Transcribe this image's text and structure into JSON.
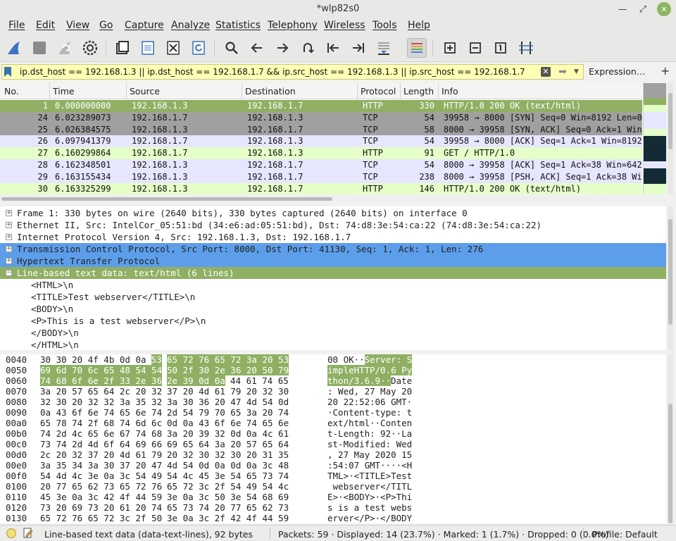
{
  "window": {
    "title": "*wlp82s0"
  },
  "menu": [
    "File",
    "Edit",
    "View",
    "Go",
    "Capture",
    "Analyze",
    "Statistics",
    "Telephony",
    "Wireless",
    "Tools",
    "Help"
  ],
  "toolbar_icons": [
    "shark-fin-start-icon",
    "stop-capture-icon",
    "restart-capture-icon",
    "capture-options-icon",
    "open-file-icon",
    "save-file-icon",
    "close-file-icon",
    "reload-file-icon",
    "find-packet-icon",
    "go-back-icon",
    "go-forward-icon",
    "go-to-packet-icon",
    "first-packet-icon",
    "last-packet-icon",
    "autoscroll-icon",
    "colorize-icon",
    "zoom-in-icon",
    "zoom-out-icon",
    "normal-size-icon",
    "resize-columns-icon"
  ],
  "filter": {
    "value": "ip.dst_host == 192.168.1.3 || ip.dst_host == 192.168.1.7 && ip.src_host == 192.168.1.3 || ip.src_host == 192.168.1.7",
    "expression_label": "Expression…",
    "add_label": "+"
  },
  "packet_columns": [
    "No.",
    "Time",
    "Source",
    "Destination",
    "Protocol",
    "Length",
    "Info"
  ],
  "packets": [
    {
      "no": "1",
      "time": "0.000000000",
      "src": "192.168.1.3",
      "dst": "192.168.1.7",
      "proto": "HTTP",
      "len": "330",
      "info": "HTTP/1.0 200 OK  (text/html)",
      "kind": "selected"
    },
    {
      "no": "24",
      "time": "6.023289073",
      "src": "192.168.1.7",
      "dst": "192.168.1.3",
      "proto": "TCP",
      "len": "54",
      "info": "39958 → 8000 [SYN] Seq=0 Win=8192 Len=0",
      "kind": "syn"
    },
    {
      "no": "25",
      "time": "6.026384575",
      "src": "192.168.1.3",
      "dst": "192.168.1.7",
      "proto": "TCP",
      "len": "58",
      "info": "8000 → 39958 [SYN, ACK] Seq=0 Ack=1 Win=64240",
      "kind": "syn"
    },
    {
      "no": "26",
      "time": "6.097941379",
      "src": "192.168.1.7",
      "dst": "192.168.1.3",
      "proto": "TCP",
      "len": "54",
      "info": "39958 → 8000 [ACK] Seq=1 Ack=1 Win=8192",
      "kind": "tcp"
    },
    {
      "no": "27",
      "time": "6.160299864",
      "src": "192.168.1.7",
      "dst": "192.168.1.3",
      "proto": "HTTP",
      "len": "91",
      "info": "GET / HTTP/1.0",
      "kind": "http"
    },
    {
      "no": "28",
      "time": "6.162348501",
      "src": "192.168.1.3",
      "dst": "192.168.1.7",
      "proto": "TCP",
      "len": "54",
      "info": "8000 → 39958 [ACK] Seq=1 Ack=38 Win=64203",
      "kind": "tcp"
    },
    {
      "no": "29",
      "time": "6.163155434",
      "src": "192.168.1.3",
      "dst": "192.168.1.7",
      "proto": "TCP",
      "len": "238",
      "info": "8000 → 39958 [PSH, ACK] Seq=1 Ack=38 Win=64203",
      "kind": "tcp"
    },
    {
      "no": "30",
      "time": "6.163325299",
      "src": "192.168.1.3",
      "dst": "192.168.1.7",
      "proto": "HTTP",
      "len": "146",
      "info": "HTTP/1.0 200 OK  (text/html)",
      "kind": "http"
    }
  ],
  "details": [
    {
      "text": "Frame 1: 330 bytes on wire (2640 bits), 330 bytes captured (2640 bits) on interface 0",
      "expander": "+",
      "style": "plain"
    },
    {
      "text": "Ethernet II, Src: IntelCor_05:51:bd (34:e6:ad:05:51:bd), Dst: 74:d8:3e:54:ca:22 (74:d8:3e:54:ca:22)",
      "expander": "+",
      "style": "plain"
    },
    {
      "text": "Internet Protocol Version 4, Src: 192.168.1.3, Dst: 192.168.1.7",
      "expander": "+",
      "style": "plain"
    },
    {
      "text": "Transmission Control Protocol, Src Port: 8000, Dst Port: 41130, Seq: 1, Ack: 1, Len: 276",
      "expander": "+",
      "style": "blue"
    },
    {
      "text": "Hypertext Transfer Protocol",
      "expander": "+",
      "style": "blue"
    },
    {
      "text": "Line-based text data: text/html (6 lines)",
      "expander": "−",
      "style": "green"
    },
    {
      "text": "<HTML>\\n",
      "expander": "",
      "style": "sub"
    },
    {
      "text": "<TITLE>Test webserver</TITLE>\\n",
      "expander": "",
      "style": "sub"
    },
    {
      "text": "<BODY>\\n",
      "expander": "",
      "style": "sub"
    },
    {
      "text": "<P>This is a test webserver</P>\\n",
      "expander": "",
      "style": "sub"
    },
    {
      "text": "</BODY>\\n",
      "expander": "",
      "style": "sub"
    },
    {
      "text": "</HTML>\\n",
      "expander": "",
      "style": "sub"
    }
  ],
  "hex_rows": [
    {
      "off": "0040",
      "b1": "30 30 20 4f 4b 0d 0a",
      "b2": "53",
      "b3": "65 72 76 65 72 3a 20 53",
      "a1": "00 OK··",
      "a2": "S",
      "a3": "erver: S",
      "hl": "b2b3"
    },
    {
      "off": "0050",
      "b1": "",
      "b2": "69 6d 70 6c 65 48 54 54",
      "b3": "50 2f 30 2e 36 20 50 79",
      "a1": "",
      "a2": "impleHTT",
      "a3": "P/0.6 Py",
      "hl": "all"
    },
    {
      "off": "0060",
      "b1": "",
      "b2": "74 68 6f 6e 2f 33 2e 36",
      "b3": "2e 39 0d 0a",
      "b3b": "44 61 74 65",
      "a1": "",
      "a2": "thon/3.6",
      "a3": ".9··",
      "a3b": "Date",
      "hl": "partial"
    },
    {
      "off": "0070",
      "b1": "3a 20 57 65 64 2c 20 32",
      "b3": "37 20 4d 61 79 20 32 30",
      "a1": ": Wed, 2",
      "a3": "7 May 20",
      "hl": "none"
    },
    {
      "off": "0080",
      "b1": "32 30 20 32 32 3a 35 32",
      "b3": "3a 30 36 20 47 4d 54 0d",
      "a1": "20 22:52",
      "a3": ":06 GMT·",
      "hl": "none"
    },
    {
      "off": "0090",
      "b1": "0a 43 6f 6e 74 65 6e 74",
      "b3": "2d 54 79 70 65 3a 20 74",
      "a1": "·Content",
      "a3": "-type: t",
      "hl": "none"
    },
    {
      "off": "00a0",
      "b1": "65 78 74 2f 68 74 6d 6c",
      "b3": "0d 0a 43 6f 6e 74 65 6e",
      "a1": "ext/html",
      "a3": "··Conten",
      "hl": "none"
    },
    {
      "off": "00b0",
      "b1": "74 2d 4c 65 6e 67 74 68",
      "b3": "3a 20 39 32 0d 0a 4c 61",
      "a1": "t-Length",
      "a3": ": 92··La",
      "hl": "none"
    },
    {
      "off": "00c0",
      "b1": "73 74 2d 4d 6f 64 69 66",
      "b3": "69 65 64 3a 20 57 65 64",
      "a1": "st-Modif",
      "a3": "ied: Wed",
      "hl": "none"
    },
    {
      "off": "00d0",
      "b1": "2c 20 32 37 20 4d 61 79",
      "b3": "20 32 30 32 30 20 31 35",
      "a1": ", 27 May",
      "a3": " 2020 15",
      "hl": "none"
    },
    {
      "off": "00e0",
      "b1": "3a 35 34 3a 30 37 20 47",
      "b3": "4d 54 0d 0a 0d 0a 3c 48",
      "a1": ":54:07 G",
      "a3": "MT····<H",
      "hl": "none"
    },
    {
      "off": "00f0",
      "b1": "54 4d 4c 3e 0a 3c 54 49",
      "b3": "54 4c 45 3e 54 65 73 74",
      "a1": "TML>·<TI",
      "a3": "TLE>Test",
      "hl": "none"
    },
    {
      "off": "0100",
      "b1": "20 77 65 62 73 65 72 76",
      "b3": "65 72 3c 2f 54 49 54 4c",
      "a1": " webserv",
      "a3": "er</TITL",
      "hl": "none"
    },
    {
      "off": "0110",
      "b1": "45 3e 0a 3c 42 4f 44 59",
      "b3": "3e 0a 3c 50 3e 54 68 69",
      "a1": "E>·<BODY",
      "a3": ">·<P>Thi",
      "hl": "none"
    },
    {
      "off": "0120",
      "b1": "73 20 69 73 20 61 20 74",
      "b3": "65 73 74 20 77 65 62 73",
      "a1": "s is a t",
      "a3": "est webs",
      "hl": "none"
    },
    {
      "off": "0130",
      "b1": "65 72 76 65 72 3c 2f 50",
      "b3": "3e 0a 3c 2f 42 4f 44 59",
      "a1": "erver</P",
      "a3": ">·</BODY",
      "hl": "none"
    }
  ],
  "status": {
    "field": "Line-based text data (data-text-lines), 92 bytes",
    "packets": "Packets: 59 · Displayed: 14 (23.7%) · Marked: 1 (1.7%) · Dropped: 0 (0.0%)",
    "profile": "Profile: Default"
  },
  "colors": {
    "selected_row": "#8fb063",
    "syn_row": "#a0a0a0",
    "tcp_row": "#e7e6ff",
    "http_row": "#e4ffc7",
    "blue_detail": "#5d9eea",
    "green_detail": "#8fb063",
    "filter_bg": "#ffffb4"
  }
}
